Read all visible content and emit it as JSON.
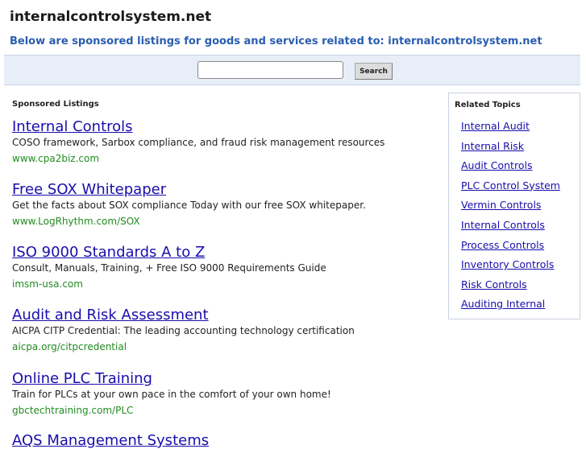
{
  "header": {
    "site_title": "internalcontrolsystem.net",
    "subtitle": "Below are sponsored listings for goods and services related to: internalcontrolsystem.net"
  },
  "search": {
    "value": "",
    "button_label": "Search"
  },
  "sponsored": {
    "heading": "Sponsored Listings",
    "listings": [
      {
        "title": "Internal Controls",
        "description": "COSO framework, Sarbox compliance, and fraud risk management resources",
        "url": "www.cpa2biz.com"
      },
      {
        "title": "Free SOX Whitepaper",
        "description": "Get the facts about SOX compliance Today with our free SOX whitepaper.",
        "url": "www.LogRhythm.com/SOX"
      },
      {
        "title": "ISO 9000 Standards A to Z",
        "description": "Consult, Manuals, Training, + Free ISO 9000 Requirements Guide",
        "url": "imsm-usa.com"
      },
      {
        "title": "Audit and Risk Assessment",
        "description": "AICPA CITP Credential: The leading accounting technology certification",
        "url": "aicpa.org/citpcredential"
      },
      {
        "title": "Online PLC Training",
        "description": "Train for PLCs at your own pace in the comfort of your own home!",
        "url": "gbctechtraining.com/PLC"
      },
      {
        "title": "AQS Management Systems",
        "description": "",
        "url": ""
      }
    ]
  },
  "related": {
    "heading": "Related Topics",
    "items": [
      "Internal Audit",
      "Internal Risk",
      "Audit Controls",
      "PLC Control System",
      "Vermin Controls",
      "Internal Controls",
      "Process Controls",
      "Inventory Controls",
      "Risk Controls",
      "Auditing Internal"
    ]
  },
  "colors": {
    "link": "#1a0dab",
    "url_green": "#228b22",
    "subtitle_blue": "#2a5db0",
    "search_bar_bg": "#e8eef8"
  }
}
